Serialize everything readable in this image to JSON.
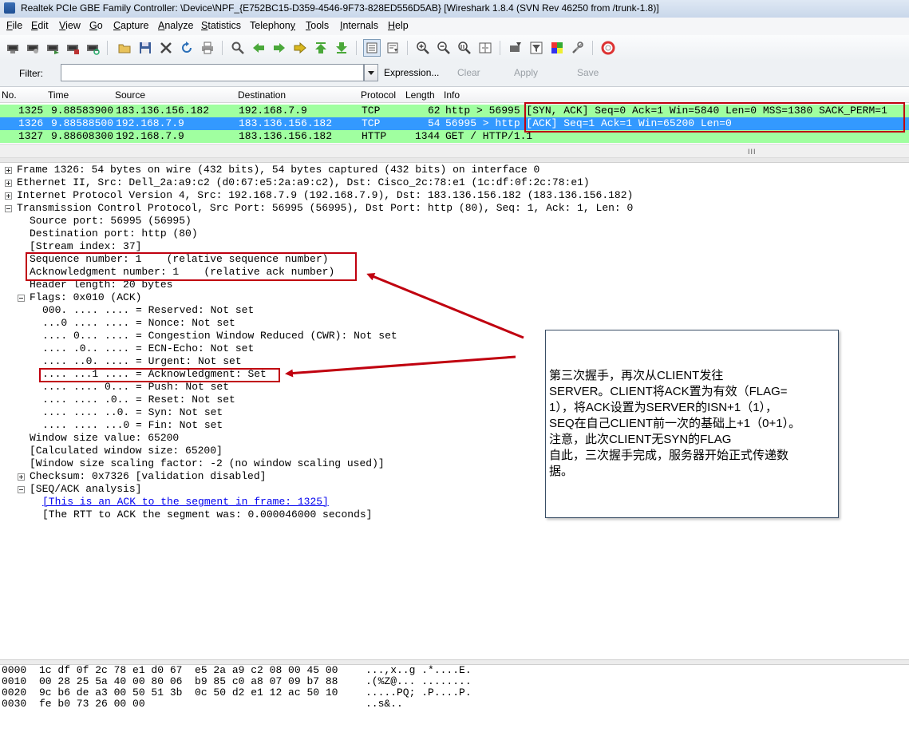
{
  "window": {
    "title": "Realtek PCIe GBE Family Controller: \\Device\\NPF_{E752BC15-D359-4546-9F73-828ED556D5AB}  [Wireshark 1.8.4  (SVN Rev 46250 from /trunk-1.8)]"
  },
  "menu": {
    "items": [
      {
        "pre": "",
        "u": "F",
        "post": "ile"
      },
      {
        "pre": "",
        "u": "E",
        "post": "dit"
      },
      {
        "pre": "",
        "u": "V",
        "post": "iew"
      },
      {
        "pre": "",
        "u": "G",
        "post": "o"
      },
      {
        "pre": "",
        "u": "C",
        "post": "apture"
      },
      {
        "pre": "",
        "u": "A",
        "post": "nalyze"
      },
      {
        "pre": "",
        "u": "S",
        "post": "tatistics"
      },
      {
        "pre": "Telephon",
        "u": "y",
        "post": ""
      },
      {
        "pre": "",
        "u": "T",
        "post": "ools"
      },
      {
        "pre": "",
        "u": "I",
        "post": "nternals"
      },
      {
        "pre": "",
        "u": "H",
        "post": "elp"
      }
    ]
  },
  "toolbar": {
    "icons": [
      "interface-list-icon",
      "capture-options-icon",
      "start-capture-icon",
      "stop-capture-icon",
      "restart-capture-icon",
      "open-file-icon",
      "save-file-icon",
      "close-file-icon",
      "reload-icon",
      "print-icon",
      "find-packet-icon",
      "go-back-icon",
      "go-forward-icon",
      "go-to-packet-icon",
      "go-first-icon",
      "go-last-icon",
      "colorize-icon",
      "autoscroll-icon",
      "zoom-in-icon",
      "zoom-out-icon",
      "zoom-normal-icon",
      "resize-columns-icon",
      "capture-filters-icon",
      "display-filters-icon",
      "coloring-rules-icon",
      "preferences-icon",
      "help-icon"
    ]
  },
  "filter": {
    "label": "Filter:",
    "value": "",
    "expression": "Expression...",
    "clear": "Clear",
    "apply": "Apply",
    "save": "Save"
  },
  "columns": [
    "No.",
    "Time",
    "Source",
    "Destination",
    "Protocol",
    "Length",
    "Info"
  ],
  "packets": [
    {
      "no": "1325",
      "time": "9.88583900",
      "src": "183.136.156.182",
      "dst": "192.168.7.9",
      "proto": "TCP",
      "len": "62",
      "info": "http > 56995 [SYN, ACK] Seq=0 Ack=1 Win=5840 Len=0 MSS=1380 SACK_PERM=1"
    },
    {
      "no": "1326",
      "time": "9.88588500",
      "src": "192.168.7.9",
      "dst": "183.136.156.182",
      "proto": "TCP",
      "len": "54",
      "info": "56995 > http [ACK] Seq=1 Ack=1 Win=65200 Len=0"
    },
    {
      "no": "1327",
      "time": "9.88608300",
      "src": "192.168.7.9",
      "dst": "183.136.156.182",
      "proto": "HTTP",
      "len": "1344",
      "info": "GET / HTTP/1.1"
    }
  ],
  "scrollbar_grip": "III",
  "details": {
    "frame": "Frame 1326: 54 bytes on wire (432 bits), 54 bytes captured (432 bits) on interface 0",
    "eth": "Ethernet II, Src: Dell_2a:a9:c2 (d0:67:e5:2a:a9:c2), Dst: Cisco_2c:78:e1 (1c:df:0f:2c:78:e1)",
    "ip": "Internet Protocol Version 4, Src: 192.168.7.9 (192.168.7.9), Dst: 183.136.156.182 (183.136.156.182)",
    "tcp": "Transmission Control Protocol, Src Port: 56995 (56995), Dst Port: http (80), Seq: 1, Ack: 1, Len: 0",
    "srcport": "Source port: 56995 (56995)",
    "dstport": "Destination port: http (80)",
    "stream": "[Stream index: 37]",
    "seq": "Sequence number: 1    (relative sequence number)",
    "ack": "Acknowledgment number: 1    (relative ack number)",
    "hdrlen": "Header length: 20 bytes",
    "flags": "Flags: 0x010 (ACK)",
    "f_reserved": "000. .... .... = Reserved: Not set",
    "f_nonce": "...0 .... .... = Nonce: Not set",
    "f_cwr": ".... 0... .... = Congestion Window Reduced (CWR): Not set",
    "f_ecn": ".... .0.. .... = ECN-Echo: Not set",
    "f_urg": ".... ..0. .... = Urgent: Not set",
    "f_ack": ".... ...1 .... = Acknowledgment: Set",
    "f_push": ".... .... 0... = Push: Not set",
    "f_reset": ".... .... .0.. = Reset: Not set",
    "f_syn": ".... .... ..0. = Syn: Not set",
    "f_fin": ".... .... ...0 = Fin: Not set",
    "win": "Window size value: 65200",
    "calcwin": "[Calculated window size: 65200]",
    "scale": "[Window size scaling factor: -2 (no window scaling used)]",
    "checksum": "Checksum: 0x7326 [validation disabled]",
    "seqack": "[SEQ/ACK analysis]",
    "ackof": "[This is an ACK to the segment in frame: 1325]",
    "rtt": "[The RTT to ACK the segment was: 0.000046000 seconds]"
  },
  "annotation": {
    "line1": "第三次握手，再次从CLIENT发往",
    "line2": "SERVER。CLIENT将ACK置为有效（FLAG=",
    "line3": "1），将ACK设置为SERVER的ISN+1（1），",
    "line4": "SEQ在自己CLIENT前一次的基础上+1（0+1）。",
    "line5": "注意，此次CLIENT无SYN的FLAG",
    "line6": "自此，三次握手完成，服务器开始正式传递数",
    "line7": "据。"
  },
  "annotation_color": "#c0000f",
  "hex": [
    {
      "off": "0000",
      "bytes": "1c df 0f 2c 78 e1 d0 67  e5 2a a9 c2 08 00 45 00",
      "ascii": "...,x..g .*....E."
    },
    {
      "off": "0010",
      "bytes": "00 28 25 5a 40 00 80 06  b9 85 c0 a8 07 09 b7 88",
      "ascii": ".(%Z@... ........"
    },
    {
      "off": "0020",
      "bytes": "9c b6 de a3 00 50 51 3b  0c 50 d2 e1 12 ac 50 10",
      "ascii": ".....PQ; .P....P."
    },
    {
      "off": "0030",
      "bytes": "fe b0 73 26 00 00",
      "ascii": "..s&.."
    }
  ]
}
